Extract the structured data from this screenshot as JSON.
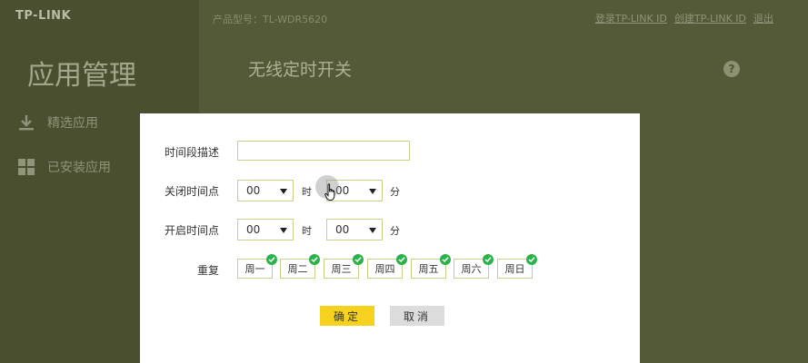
{
  "header": {
    "logo": "TP-LINK",
    "model": "产品型号：TL-WDR5620",
    "links": [
      "登录TP-LINK ID",
      "创建TP-LINK ID",
      "退出"
    ]
  },
  "sidebar": {
    "title": "应用管理",
    "items": [
      {
        "label": "精选应用",
        "icon": "download-icon"
      },
      {
        "label": "已安装应用",
        "icon": "grid-icon"
      }
    ]
  },
  "main": {
    "heading": "无线定时开关",
    "help": "?"
  },
  "dialog": {
    "desc_label": "时间段描述",
    "desc_value": "",
    "close_label": "关闭时间点",
    "open_label": "开启时间点",
    "close_hour": "00",
    "close_minute": "00",
    "open_hour": "00",
    "open_minute": "00",
    "hour_unit": "时",
    "minute_unit": "分",
    "repeat_label": "重复",
    "days": [
      {
        "label": "周一",
        "checked": true
      },
      {
        "label": "周二",
        "checked": true
      },
      {
        "label": "周三",
        "checked": true
      },
      {
        "label": "周四",
        "checked": true
      },
      {
        "label": "周五",
        "checked": true
      },
      {
        "label": "周六",
        "checked": true
      },
      {
        "label": "周日",
        "checked": true
      }
    ],
    "ok_label": "确定",
    "cancel_label": "取消"
  },
  "colors": {
    "accent_yellow": "#f6d21e",
    "check_green": "#2bb34b",
    "input_border": "#c8cf8a"
  }
}
